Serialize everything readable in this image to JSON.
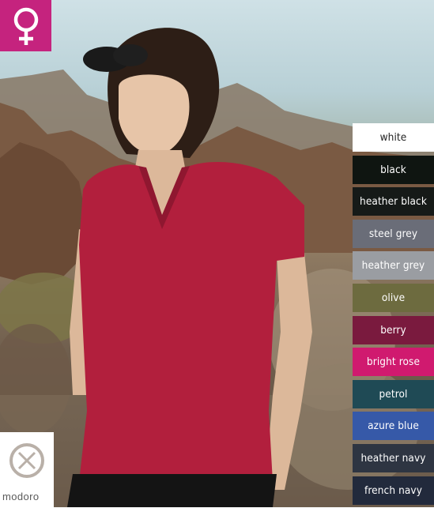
{
  "gender": {
    "icon": "female-symbol-icon",
    "color": "#c5237e"
  },
  "colors": [
    {
      "label": "white",
      "bg": "#ffffff",
      "fg": "#222222"
    },
    {
      "label": "black",
      "bg": "#0f1511",
      "fg": "#ffffff"
    },
    {
      "label": "heather black",
      "bg": "#161a18",
      "fg": "#ffffff"
    },
    {
      "label": "steel grey",
      "bg": "#6a6d78",
      "fg": "#ffffff"
    },
    {
      "label": "heather grey",
      "bg": "#9a9da2",
      "fg": "#ffffff"
    },
    {
      "label": "olive",
      "bg": "#6d6b3f",
      "fg": "#ffffff"
    },
    {
      "label": "berry",
      "bg": "#7a1a3e",
      "fg": "#ffffff"
    },
    {
      "label": "bright rose",
      "bg": "#d01a6f",
      "fg": "#ffffff"
    },
    {
      "label": "petrol",
      "bg": "#1f4a55",
      "fg": "#ffffff"
    },
    {
      "label": "azure blue",
      "bg": "#3659a8",
      "fg": "#ffffff"
    },
    {
      "label": "heather navy",
      "bg": "#2e3542",
      "fg": "#ffffff"
    },
    {
      "label": "french navy",
      "bg": "#222a3c",
      "fg": "#ffffff"
    }
  ],
  "brand": {
    "name": "modoro",
    "icon": "circled-x-logo-icon"
  }
}
